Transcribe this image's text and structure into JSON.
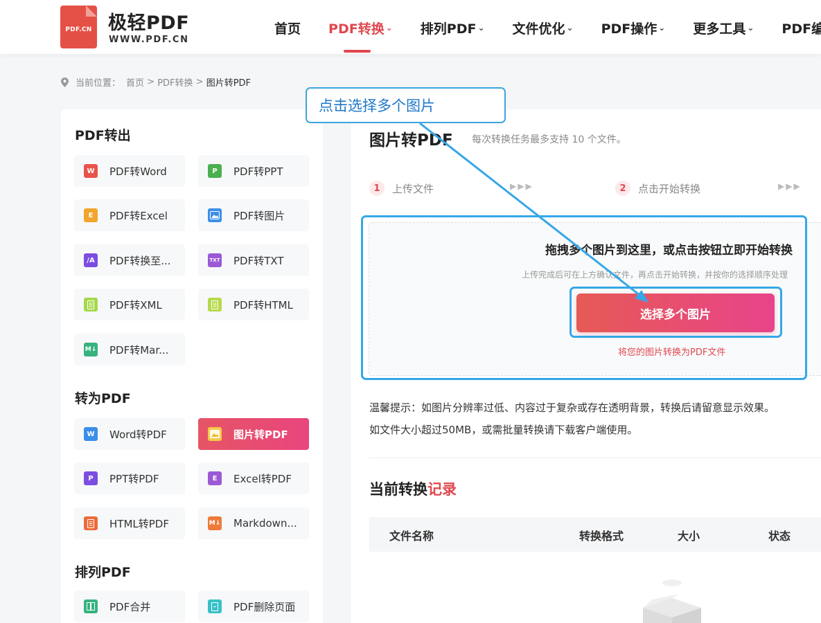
{
  "header": {
    "logo_text": "PDF.CN",
    "brand_name": "极轻PDF",
    "brand_url": "WWW.PDF.CN",
    "nav": [
      {
        "label": "首页",
        "dropdown": false,
        "active": false
      },
      {
        "label": "PDF转换",
        "dropdown": true,
        "active": true
      },
      {
        "label": "排列PDF",
        "dropdown": true,
        "active": false
      },
      {
        "label": "文件优化",
        "dropdown": true,
        "active": false
      },
      {
        "label": "PDF操作",
        "dropdown": true,
        "active": false
      },
      {
        "label": "更多工具",
        "dropdown": true,
        "active": false
      },
      {
        "label": "PDF编",
        "dropdown": false,
        "active": false
      }
    ]
  },
  "breadcrumb": {
    "prefix": "当前位置：",
    "home": "首页",
    "sep1": " > ",
    "parent": "PDF转换",
    "sep2": " > ",
    "current": "图片转PDF"
  },
  "sidebar": {
    "sections": [
      {
        "title": "PDF转出",
        "items": [
          {
            "label": "PDF转Word",
            "icon": "W",
            "color": "#e9534c"
          },
          {
            "label": "PDF转PPT",
            "icon": "P",
            "color": "#4caf50"
          },
          {
            "label": "PDF转Excel",
            "icon": "E",
            "color": "#f0a52c"
          },
          {
            "label": "PDF转图片",
            "icon": "image",
            "color": "#3b8ee8"
          },
          {
            "label": "PDF转换至...",
            "icon": "/A",
            "color": "#7b4de0"
          },
          {
            "label": "PDF转TXT",
            "icon": "TXT",
            "color": "#9b59d6"
          },
          {
            "label": "PDF转XML",
            "icon": "doc",
            "color": "#a5d94a"
          },
          {
            "label": "PDF转HTML",
            "icon": "doc",
            "color": "#b5d94a"
          },
          {
            "label": "PDF转Mar...",
            "icon": "M↓",
            "color": "#36b37e"
          }
        ]
      },
      {
        "title": "转为PDF",
        "items": [
          {
            "label": "Word转PDF",
            "icon": "W",
            "color": "#3b8ee8"
          },
          {
            "label": "图片转PDF",
            "icon": "image",
            "color": "#f0b72c",
            "active": true
          },
          {
            "label": "PPT转PDF",
            "icon": "P",
            "color": "#7b4de0"
          },
          {
            "label": "Excel转PDF",
            "icon": "E",
            "color": "#9b59d6"
          },
          {
            "label": "HTML转PDF",
            "icon": "doc",
            "color": "#ee6a3b"
          },
          {
            "label": "Markdown...",
            "icon": "M↓",
            "color": "#ee7a3b"
          }
        ]
      },
      {
        "title": "排列PDF",
        "items": [
          {
            "label": "PDF合并",
            "icon": "merge",
            "color": "#36b37e"
          },
          {
            "label": "PDF删除页面",
            "icon": "page",
            "color": "#38c0c8"
          }
        ]
      }
    ]
  },
  "main": {
    "title": "图片转PDF",
    "subtitle": "每次转换任务最多支持 10 个文件。",
    "steps": [
      {
        "num": "1",
        "label": "上传文件"
      },
      {
        "num": "2",
        "label": "点击开始转换"
      }
    ],
    "step_arrows": "▶▶▶",
    "dropzone": {
      "title": "拖拽多个图片到这里，或点击按钮立即开始转换",
      "subtitle": "上传完成后可在上方确认文件，再点击开始转换，并按你的选择顺序处理",
      "button": "选择多个图片",
      "note": "将您的图片转换为PDF文件"
    },
    "tips": [
      "温馨提示：如图片分辨率过低、内容过于复杂或存在透明背景，转换后请留意显示效果。",
      "如文件大小超过50MB，或需批量转换请下载客户端使用。"
    ],
    "records": {
      "title_main": "当前转换",
      "title_hl": "记录",
      "columns": [
        "文件名称",
        "转换格式",
        "大小",
        "状态"
      ]
    }
  },
  "annotation": {
    "callout_text": "点击选择多个图片",
    "color": "#35a7e8"
  }
}
